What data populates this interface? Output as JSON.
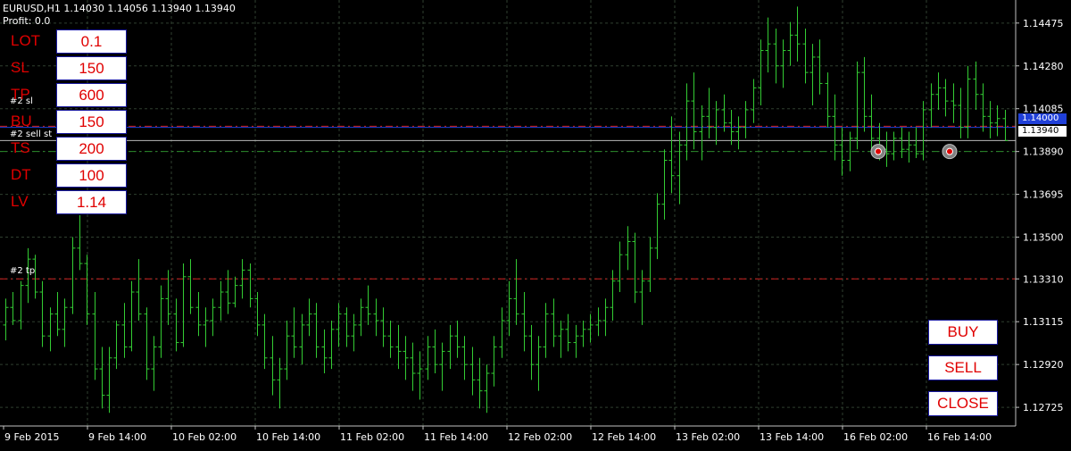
{
  "header": {
    "symbol_line": "EURUSD,H1  1.14030 1.14056 1.13940 1.13940",
    "profit_line": "Profit: 0.0"
  },
  "panel": {
    "fields": [
      {
        "label": "LOT",
        "value": "0.1"
      },
      {
        "label": "SL",
        "value": "150"
      },
      {
        "label": "TP",
        "value": "600"
      },
      {
        "label": "BU",
        "value": "150"
      },
      {
        "label": "TS",
        "value": "200"
      },
      {
        "label": "DT",
        "value": "100"
      },
      {
        "label": "LV",
        "value": "1.14"
      }
    ]
  },
  "buttons": {
    "buy": "BUY",
    "sell": "SELL",
    "close": "CLOSE"
  },
  "lines": {
    "sl_label": "#2 sl",
    "sell_label": "#2 sell st",
    "tp_label": "#2 tp",
    "sl_price": 1.14005,
    "bu_price": 1.14,
    "current_price": 1.1394,
    "entry_price": 1.1389,
    "tp_price": 1.1331
  },
  "price_tags": {
    "level": "1.14000",
    "current": "1.13940"
  },
  "colors": {
    "background": "#000000",
    "grid": "#2f3f2f",
    "candle": "#33cc33",
    "sl_line": "#d02020",
    "entry_line": "#2a8a2a",
    "level_line": "#1f3fd8",
    "accent": "#e00000"
  },
  "chart_data": {
    "type": "ohlc",
    "symbol": "EURUSD",
    "timeframe": "H1",
    "ylim": [
      1.1264,
      1.1458
    ],
    "y_ticks": [
      "1.14475",
      "1.14280",
      "1.14085",
      "1.13890",
      "1.13695",
      "1.13500",
      "1.13310",
      "1.13115",
      "1.12920",
      "1.12725"
    ],
    "x_ticks": [
      "9 Feb 2015",
      "9 Feb 14:00",
      "10 Feb 02:00",
      "10 Feb 14:00",
      "11 Feb 02:00",
      "11 Feb 14:00",
      "12 Feb 02:00",
      "12 Feb 14:00",
      "13 Feb 02:00",
      "13 Feb 14:00",
      "16 Feb 02:00",
      "16 Feb 14:00"
    ],
    "bars": [
      [
        1.131,
        1.1322,
        1.1303,
        1.1318
      ],
      [
        1.1318,
        1.1325,
        1.131,
        1.1312
      ],
      [
        1.1312,
        1.133,
        1.1308,
        1.1328
      ],
      [
        1.1328,
        1.1345,
        1.132,
        1.134
      ],
      [
        1.134,
        1.1342,
        1.1322,
        1.1325
      ],
      [
        1.1325,
        1.133,
        1.13,
        1.1305
      ],
      [
        1.1305,
        1.1318,
        1.1298,
        1.1315
      ],
      [
        1.1315,
        1.1325,
        1.1305,
        1.1308
      ],
      [
        1.1308,
        1.1322,
        1.13,
        1.1318
      ],
      [
        1.1318,
        1.135,
        1.1315,
        1.1345
      ],
      [
        1.1345,
        1.136,
        1.1335,
        1.1338
      ],
      [
        1.1338,
        1.1342,
        1.131,
        1.1315
      ],
      [
        1.1315,
        1.1325,
        1.1285,
        1.129
      ],
      [
        1.129,
        1.13,
        1.1272,
        1.1278
      ],
      [
        1.1278,
        1.13,
        1.127,
        1.1295
      ],
      [
        1.1295,
        1.1312,
        1.129,
        1.131
      ],
      [
        1.131,
        1.132,
        1.1295,
        1.13
      ],
      [
        1.13,
        1.133,
        1.1298,
        1.1325
      ],
      [
        1.1325,
        1.134,
        1.1312,
        1.1315
      ],
      [
        1.1315,
        1.1318,
        1.1285,
        1.129
      ],
      [
        1.129,
        1.1305,
        1.128,
        1.13
      ],
      [
        1.13,
        1.1328,
        1.1295,
        1.1322
      ],
      [
        1.1322,
        1.1335,
        1.131,
        1.1315
      ],
      [
        1.1315,
        1.1322,
        1.1298,
        1.1302
      ],
      [
        1.1302,
        1.1338,
        1.13,
        1.1332
      ],
      [
        1.1332,
        1.134,
        1.1315,
        1.1318
      ],
      [
        1.1318,
        1.1325,
        1.1305,
        1.131
      ],
      [
        1.131,
        1.1318,
        1.13,
        1.1312
      ],
      [
        1.1312,
        1.1322,
        1.1305,
        1.1318
      ],
      [
        1.1318,
        1.133,
        1.1312,
        1.1325
      ],
      [
        1.1325,
        1.1335,
        1.1315,
        1.132
      ],
      [
        1.132,
        1.1332,
        1.1318,
        1.1328
      ],
      [
        1.1328,
        1.134,
        1.1322,
        1.1335
      ],
      [
        1.1335,
        1.1338,
        1.1318,
        1.1322
      ],
      [
        1.1322,
        1.1325,
        1.1305,
        1.131
      ],
      [
        1.131,
        1.1315,
        1.129,
        1.1295
      ],
      [
        1.1295,
        1.1305,
        1.1278,
        1.1285
      ],
      [
        1.1285,
        1.1295,
        1.1272,
        1.129
      ],
      [
        1.129,
        1.1312,
        1.1285,
        1.1305
      ],
      [
        1.1305,
        1.1318,
        1.1295,
        1.13
      ],
      [
        1.13,
        1.1315,
        1.1292,
        1.131
      ],
      [
        1.131,
        1.1322,
        1.1305,
        1.1315
      ],
      [
        1.1315,
        1.132,
        1.1295,
        1.13
      ],
      [
        1.13,
        1.1308,
        1.1288,
        1.1295
      ],
      [
        1.1295,
        1.1312,
        1.129,
        1.1308
      ],
      [
        1.1308,
        1.132,
        1.13,
        1.1315
      ],
      [
        1.1315,
        1.1318,
        1.13,
        1.1305
      ],
      [
        1.1305,
        1.1315,
        1.1298,
        1.131
      ],
      [
        1.131,
        1.1322,
        1.1305,
        1.1318
      ],
      [
        1.1318,
        1.1328,
        1.131,
        1.1315
      ],
      [
        1.1315,
        1.1322,
        1.1305,
        1.1312
      ],
      [
        1.1312,
        1.1318,
        1.13,
        1.1305
      ],
      [
        1.1305,
        1.1312,
        1.1295,
        1.13
      ],
      [
        1.13,
        1.131,
        1.129,
        1.1298
      ],
      [
        1.1298,
        1.1305,
        1.1285,
        1.1295
      ],
      [
        1.1295,
        1.1302,
        1.128,
        1.1288
      ],
      [
        1.1288,
        1.1298,
        1.1276,
        1.129
      ],
      [
        1.129,
        1.1305,
        1.1285,
        1.13
      ],
      [
        1.13,
        1.1308,
        1.1288,
        1.1292
      ],
      [
        1.1292,
        1.1302,
        1.128,
        1.1298
      ],
      [
        1.1298,
        1.131,
        1.129,
        1.1305
      ],
      [
        1.1305,
        1.1312,
        1.1295,
        1.13
      ],
      [
        1.13,
        1.1305,
        1.1285,
        1.1292
      ],
      [
        1.1292,
        1.13,
        1.1278,
        1.1285
      ],
      [
        1.1285,
        1.1295,
        1.1272,
        1.128
      ],
      [
        1.128,
        1.1292,
        1.127,
        1.1288
      ],
      [
        1.1288,
        1.1305,
        1.1282,
        1.13
      ],
      [
        1.13,
        1.1318,
        1.1295,
        1.1312
      ],
      [
        1.1312,
        1.133,
        1.1305,
        1.1322
      ],
      [
        1.1322,
        1.134,
        1.131,
        1.1315
      ],
      [
        1.1315,
        1.1325,
        1.1298,
        1.1305
      ],
      [
        1.1305,
        1.131,
        1.1285,
        1.1292
      ],
      [
        1.1292,
        1.1305,
        1.128,
        1.13
      ],
      [
        1.13,
        1.132,
        1.1295,
        1.1315
      ],
      [
        1.1315,
        1.1322,
        1.13,
        1.1305
      ],
      [
        1.1305,
        1.1312,
        1.1295,
        1.1308
      ],
      [
        1.1308,
        1.1315,
        1.1298,
        1.1302
      ],
      [
        1.1302,
        1.131,
        1.1295,
        1.1305
      ],
      [
        1.1305,
        1.1312,
        1.13,
        1.1308
      ],
      [
        1.1308,
        1.1315,
        1.1302,
        1.131
      ],
      [
        1.131,
        1.1318,
        1.1305,
        1.1312
      ],
      [
        1.1312,
        1.1322,
        1.1305,
        1.1318
      ],
      [
        1.1318,
        1.1335,
        1.1312,
        1.133
      ],
      [
        1.133,
        1.1348,
        1.1325,
        1.1342
      ],
      [
        1.1342,
        1.1355,
        1.1335,
        1.1348
      ],
      [
        1.1348,
        1.1352,
        1.132,
        1.1325
      ],
      [
        1.1325,
        1.1335,
        1.131,
        1.133
      ],
      [
        1.133,
        1.135,
        1.1325,
        1.1345
      ],
      [
        1.1345,
        1.137,
        1.134,
        1.1365
      ],
      [
        1.1365,
        1.139,
        1.1358,
        1.1385
      ],
      [
        1.1385,
        1.1405,
        1.137,
        1.1378
      ],
      [
        1.1378,
        1.1398,
        1.1365,
        1.1392
      ],
      [
        1.1392,
        1.142,
        1.1385,
        1.1412
      ],
      [
        1.1412,
        1.1425,
        1.139,
        1.1398
      ],
      [
        1.1398,
        1.141,
        1.1385,
        1.1405
      ],
      [
        1.1405,
        1.1418,
        1.1395,
        1.14
      ],
      [
        1.14,
        1.1412,
        1.1392,
        1.1408
      ],
      [
        1.1408,
        1.1415,
        1.1398,
        1.1402
      ],
      [
        1.1402,
        1.1408,
        1.1392,
        1.1398
      ],
      [
        1.1398,
        1.1405,
        1.139,
        1.14
      ],
      [
        1.14,
        1.1412,
        1.1395,
        1.1408
      ],
      [
        1.1408,
        1.1422,
        1.1402,
        1.1418
      ],
      [
        1.1418,
        1.144,
        1.141,
        1.1435
      ],
      [
        1.1435,
        1.145,
        1.1425,
        1.1438
      ],
      [
        1.1438,
        1.1445,
        1.142,
        1.1428
      ],
      [
        1.1428,
        1.144,
        1.1418,
        1.1435
      ],
      [
        1.1435,
        1.1448,
        1.1428,
        1.1442
      ],
      [
        1.1442,
        1.1455,
        1.143,
        1.1438
      ],
      [
        1.1438,
        1.1445,
        1.142,
        1.1425
      ],
      [
        1.1425,
        1.1438,
        1.141,
        1.1432
      ],
      [
        1.1432,
        1.144,
        1.1415,
        1.142
      ],
      [
        1.142,
        1.1425,
        1.14,
        1.1405
      ],
      [
        1.1405,
        1.1415,
        1.1385,
        1.1392
      ],
      [
        1.1392,
        1.14,
        1.1378,
        1.1385
      ],
      [
        1.1385,
        1.1398,
        1.138,
        1.1395
      ],
      [
        1.1395,
        1.143,
        1.139,
        1.1425
      ],
      [
        1.1425,
        1.1432,
        1.1398,
        1.1405
      ],
      [
        1.1405,
        1.1415,
        1.1388,
        1.1395
      ],
      [
        1.1395,
        1.1402,
        1.1385,
        1.139
      ],
      [
        1.139,
        1.1398,
        1.1382,
        1.1388
      ],
      [
        1.1388,
        1.1398,
        1.1385,
        1.1395
      ],
      [
        1.1395,
        1.14,
        1.1386,
        1.139
      ],
      [
        1.139,
        1.1398,
        1.1384,
        1.1392
      ],
      [
        1.1392,
        1.14,
        1.1386,
        1.1388
      ],
      [
        1.1388,
        1.1412,
        1.1385,
        1.1408
      ],
      [
        1.1408,
        1.142,
        1.14,
        1.1415
      ],
      [
        1.1415,
        1.1425,
        1.1408,
        1.1418
      ],
      [
        1.1418,
        1.1422,
        1.1405,
        1.1412
      ],
      [
        1.1412,
        1.142,
        1.1402,
        1.141
      ],
      [
        1.141,
        1.1418,
        1.1395,
        1.14
      ],
      [
        1.14,
        1.1428,
        1.1395,
        1.1422
      ],
      [
        1.1422,
        1.143,
        1.1408,
        1.1415
      ],
      [
        1.1415,
        1.142,
        1.1398,
        1.1405
      ],
      [
        1.1405,
        1.1412,
        1.1395,
        1.1402
      ],
      [
        1.1402,
        1.141,
        1.1396,
        1.1404
      ],
      [
        1.1404,
        1.1408,
        1.1394,
        1.1394
      ]
    ]
  }
}
